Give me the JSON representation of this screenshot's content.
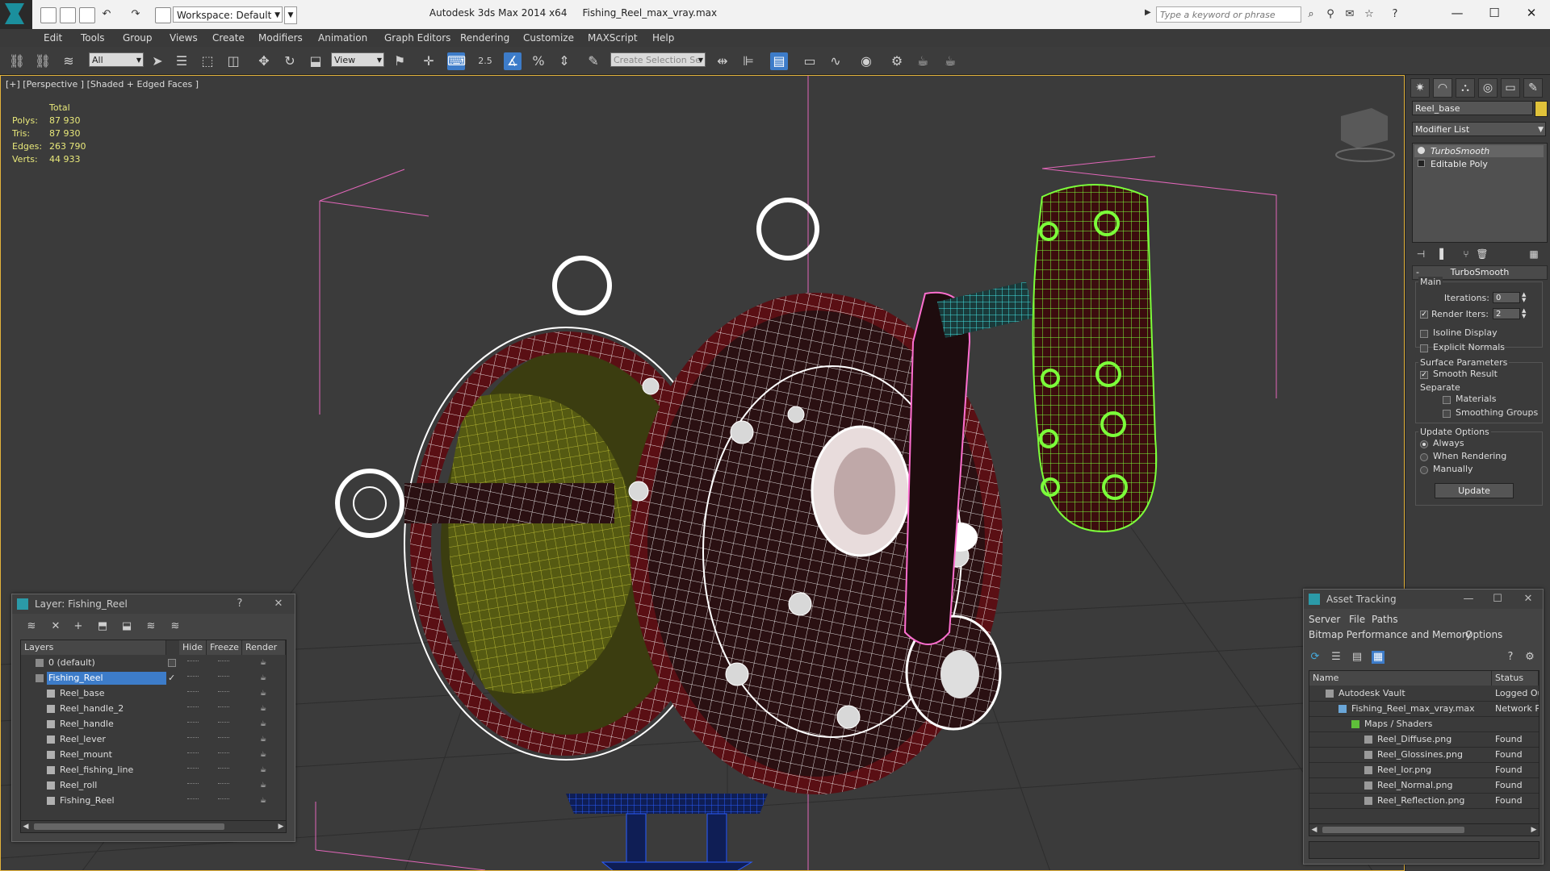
{
  "window": {
    "app_title": "Autodesk 3ds Max  2014 x64",
    "file_name": "Fishing_Reel_max_vray.max",
    "workspace": "Workspace: Default",
    "search_placeholder": "Type a keyword or phrase",
    "minimize": "—",
    "maximize": "☐",
    "close": "✕"
  },
  "menu": [
    "Edit",
    "Tools",
    "Group",
    "Views",
    "Create",
    "Modifiers",
    "Animation",
    "Graph Editors",
    "Rendering",
    "Customize",
    "MAXScript",
    "Help"
  ],
  "toolbar": {
    "selection_filter": "All",
    "ref_coord": "View",
    "snap_value": "2.5",
    "selection_set_placeholder": "Create Selection Se"
  },
  "viewport": {
    "label": "[+] [Perspective ] [Shaded + Edged Faces ]",
    "stats": {
      "header": "Total",
      "rows": [
        {
          "label": "Polys:",
          "value": "87 930"
        },
        {
          "label": "Tris:",
          "value": "87 930"
        },
        {
          "label": "Edges:",
          "value": "263 790"
        },
        {
          "label": "Verts:",
          "value": "44 933"
        }
      ]
    }
  },
  "command_panel": {
    "object_name": "Reel_base",
    "object_color": "#e0c23a",
    "modifier_list": "Modifier List",
    "stack": [
      "TurboSmooth",
      "Editable Poly"
    ],
    "rollout_title": "TurboSmooth",
    "main": {
      "group": "Main",
      "iterations_label": "Iterations:",
      "iterations_value": "0",
      "render_iters_label": "Render Iters:",
      "render_iters_value": "2",
      "render_iters_checked": true,
      "isoline_display": "Isoline Display",
      "explicit_normals": "Explicit Normals"
    },
    "surface": {
      "group": "Surface Parameters",
      "smooth_result": "Smooth Result",
      "separate": "Separate",
      "materials": "Materials",
      "smoothing_groups": "Smoothing Groups"
    },
    "update": {
      "group": "Update Options",
      "always": "Always",
      "when_rendering": "When Rendering",
      "manually": "Manually",
      "button": "Update"
    }
  },
  "layer_dialog": {
    "title": "Layer: Fishing_Reel",
    "help": "?",
    "close": "✕",
    "columns": [
      "Layers",
      "Hide",
      "Freeze",
      "Render"
    ],
    "rows": [
      {
        "name": "0 (default)",
        "level": 0,
        "selected": false
      },
      {
        "name": "Fishing_Reel",
        "level": 0,
        "selected": true
      },
      {
        "name": "Reel_base",
        "level": 1,
        "selected": false
      },
      {
        "name": "Reel_handle_2",
        "level": 1,
        "selected": false
      },
      {
        "name": "Reel_handle",
        "level": 1,
        "selected": false
      },
      {
        "name": "Reel_lever",
        "level": 1,
        "selected": false
      },
      {
        "name": "Reel_mount",
        "level": 1,
        "selected": false
      },
      {
        "name": "Reel_fishing_line",
        "level": 1,
        "selected": false
      },
      {
        "name": "Reel_roll",
        "level": 1,
        "selected": false
      },
      {
        "name": "Fishing_Reel",
        "level": 1,
        "selected": false
      }
    ]
  },
  "asset_dialog": {
    "title": "Asset Tracking",
    "menu1": [
      "Server",
      "File",
      "Paths"
    ],
    "menu2": [
      "Bitmap Performance and Memory",
      "Options"
    ],
    "columns": [
      "Name",
      "Status"
    ],
    "rows": [
      {
        "name": "Autodesk Vault",
        "status": "Logged Ou",
        "level": 0
      },
      {
        "name": "Fishing_Reel_max_vray.max",
        "status": "Network Pa",
        "level": 1
      },
      {
        "name": "Maps / Shaders",
        "status": "",
        "level": 2
      },
      {
        "name": "Reel_Diffuse.png",
        "status": "Found",
        "level": 3
      },
      {
        "name": "Reel_Glossines.png",
        "status": "Found",
        "level": 3
      },
      {
        "name": "Reel_Ior.png",
        "status": "Found",
        "level": 3
      },
      {
        "name": "Reel_Normal.png",
        "status": "Found",
        "level": 3
      },
      {
        "name": "Reel_Reflection.png",
        "status": "Found",
        "level": 3
      }
    ]
  },
  "colors": {
    "accent": "#3d7cc9",
    "viewport_border": "#e3b33b",
    "wire_white": "#ffffff",
    "wire_green": "#7cff3a",
    "wire_blue": "#2a5cff",
    "wire_pink": "#ff6fd0",
    "wire_cyan": "#43e0e0",
    "body_red": "#5a0f14",
    "spool_olive": "#555a12"
  }
}
